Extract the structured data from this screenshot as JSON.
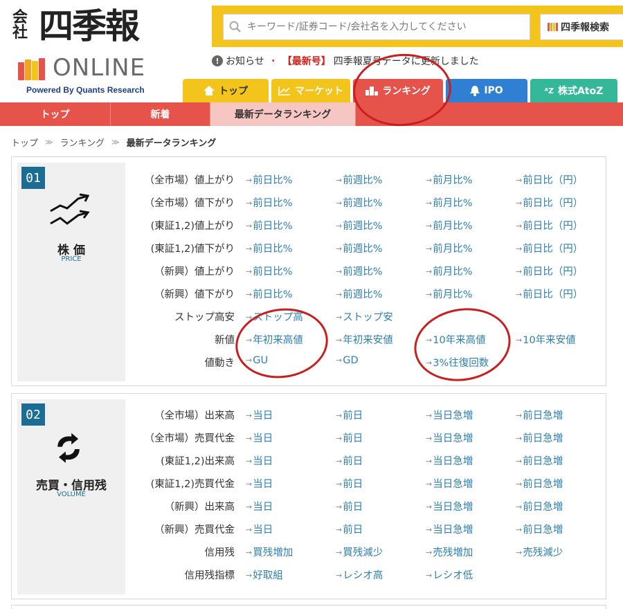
{
  "logo": {
    "kaisha": "会社",
    "main": "四季報",
    "online": "ONLINE",
    "powered": "Powered By Quants Research"
  },
  "search": {
    "placeholder": "キーワード/証券コード/会社名を入力してください",
    "button": "四季報検索"
  },
  "notice": {
    "label": "お知らせ",
    "tag": "【最新号】",
    "text": "四季報夏号データに更新しました"
  },
  "main_tabs": [
    {
      "label": "トップ",
      "icon": "home-icon",
      "bg": "#f3c51c",
      "color": "#333333"
    },
    {
      "label": "マーケット",
      "icon": "chart-line-icon",
      "bg": "#f3c51c",
      "color": "#ffffff"
    },
    {
      "label": "ランキング",
      "icon": "bar-chart-icon",
      "bg": "#e5534b",
      "color": "#ffffff"
    },
    {
      "label": "IPO",
      "icon": "bell-icon",
      "bg": "#2f7fd3",
      "color": "#ffffff"
    },
    {
      "label": "株式AtoZ",
      "icon": "atoz-icon",
      "bg": "#35b89a",
      "color": "#ffffff"
    }
  ],
  "sub_nav": [
    "トップ",
    "新着",
    "最新データランキング"
  ],
  "breadcrumb": [
    "トップ",
    "ランキング",
    "最新データランキング"
  ],
  "sections": [
    {
      "num": "01",
      "title": "株 価",
      "subtitle": "PRICE",
      "icon": "stock-chart-icon",
      "rows": [
        {
          "label": "（全市場）値上がり",
          "links": [
            "前日比%",
            "前週比%",
            "前月比%",
            "前日比（円）"
          ]
        },
        {
          "label": "（全市場）値下がり",
          "links": [
            "前日比%",
            "前週比%",
            "前月比%",
            "前日比（円）"
          ]
        },
        {
          "label": "(東証1,2)値上がり",
          "links": [
            "前日比%",
            "前週比%",
            "前月比%",
            "前日比（円）"
          ]
        },
        {
          "label": "(東証1,2)値下がり",
          "links": [
            "前日比%",
            "前週比%",
            "前月比%",
            "前日比（円）"
          ]
        },
        {
          "label": "（新興）値上がり",
          "links": [
            "前日比%",
            "前週比%",
            "前月比%",
            "前日比（円）"
          ]
        },
        {
          "label": "（新興）値下がり",
          "links": [
            "前日比%",
            "前週比%",
            "前月比%",
            "前日比（円）"
          ]
        },
        {
          "label": "ストップ高安",
          "links": [
            "ストップ高",
            "ストップ安"
          ]
        },
        {
          "label": "新値",
          "links": [
            "年初来高値",
            "年初来安値",
            "10年来高値",
            "10年来安値"
          ]
        },
        {
          "label": "値動き",
          "links": [
            "GU",
            "GD",
            "3%往復回数"
          ]
        }
      ]
    },
    {
      "num": "02",
      "title": "売買・信用残",
      "subtitle": "VOLUME",
      "icon": "exchange-arrows-icon",
      "rows": [
        {
          "label": "（全市場）出来高",
          "links": [
            "当日",
            "前日",
            "当日急増",
            "前日急増"
          ]
        },
        {
          "label": "（全市場）売買代金",
          "links": [
            "当日",
            "前日",
            "当日急増",
            "前日急増"
          ]
        },
        {
          "label": "(東証1,2)出来高",
          "links": [
            "当日",
            "前日",
            "当日急増",
            "前日急増"
          ]
        },
        {
          "label": "(東証1,2)売買代金",
          "links": [
            "当日",
            "前日",
            "当日急増",
            "前日急増"
          ]
        },
        {
          "label": "（新興）出来高",
          "links": [
            "当日",
            "前日",
            "当日急増",
            "前日急増"
          ]
        },
        {
          "label": "（新興）売買代金",
          "links": [
            "当日",
            "前日",
            "当日急増",
            "前日急増"
          ]
        },
        {
          "label": "信用残",
          "links": [
            "買残増加",
            "買残減少",
            "売残増加",
            "売残減少"
          ]
        },
        {
          "label": "信用残指標",
          "links": [
            "好取組",
            "レシオ高",
            "レシオ低"
          ]
        }
      ]
    }
  ],
  "colors": {
    "accent_yellow": "#f3c51c",
    "accent_red": "#e5534b",
    "link_blue": "#2d7fb0",
    "section_num_blue": "#1a6e96",
    "annotation_red": "#c81e1e"
  }
}
